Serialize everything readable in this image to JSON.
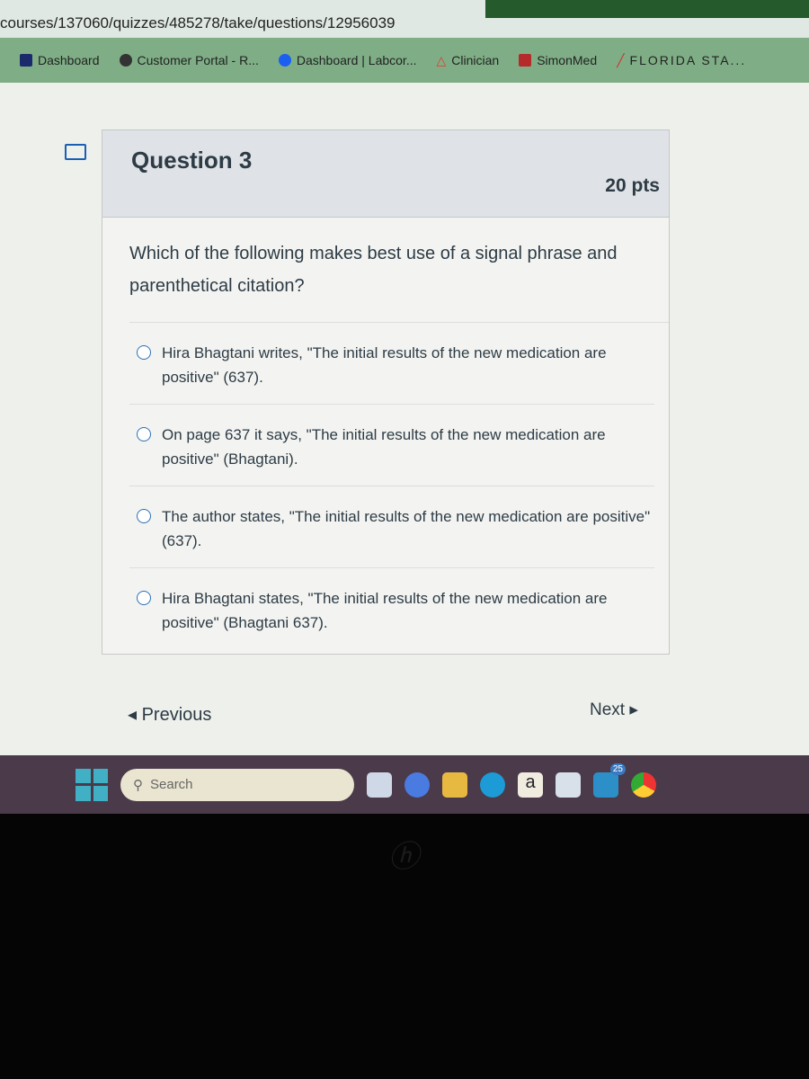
{
  "browser": {
    "url": "courses/137060/quizzes/485278/take/questions/12956039",
    "bookmarks": [
      {
        "label": "Dashboard",
        "color": "#1b2a6b"
      },
      {
        "label": "Customer Portal - R...",
        "color": "#333"
      },
      {
        "label": "Dashboard | Labcor...",
        "color": "#1a5ff0"
      },
      {
        "label": "Clinician",
        "color": "#e03a2f"
      },
      {
        "label": "SimonMed",
        "color": "#b52a2a"
      },
      {
        "label": "FLORIDA STA...",
        "color": "#c33"
      }
    ]
  },
  "question": {
    "title": "Question 3",
    "points": "20 pts",
    "text": "Which of the following makes best use of a signal phrase and parenthetical citation?",
    "answers": [
      "Hira Bhagtani writes, \"The initial results of the new medication are positive\" (637).",
      "On page 637 it says, \"The initial results of the new medication are positive\" (Bhagtani).",
      "The author states, \"The initial results of the new medication are positive\" (637).",
      "Hira Bhagtani states, \"The initial results of the new medication are positive\" (Bhagtani 637)."
    ]
  },
  "nav": {
    "previous": "◂ Previous",
    "next": "Next ▸"
  },
  "taskbar": {
    "search_placeholder": "Search",
    "mail_badge": "25",
    "apps": [
      "windows-icon",
      "task-view-icon",
      "meet-icon",
      "file-explorer-icon",
      "edge-icon",
      "amazon-icon",
      "store-icon",
      "mail-icon",
      "chrome-icon"
    ]
  },
  "logo": "hp"
}
